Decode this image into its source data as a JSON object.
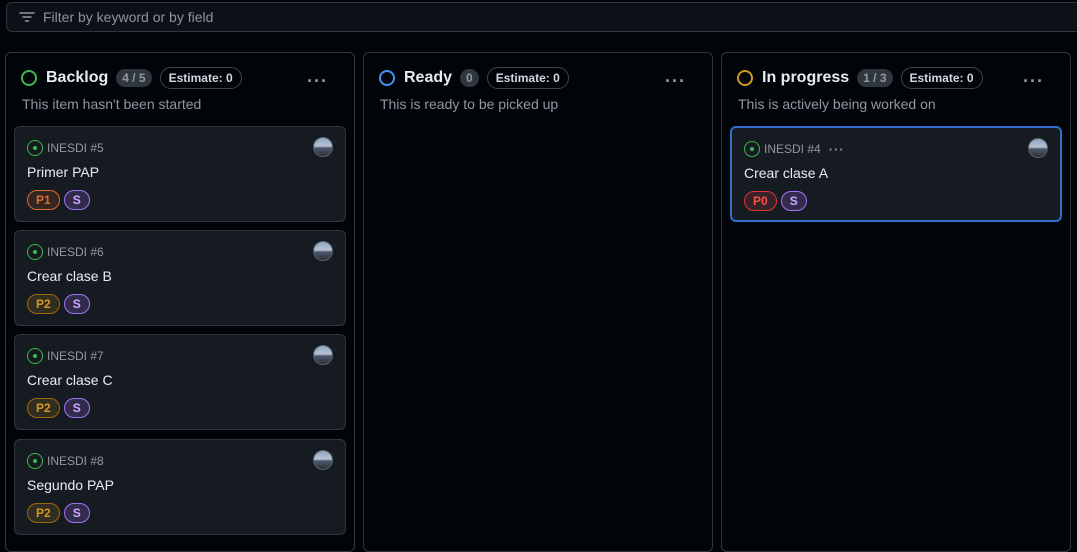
{
  "filter": {
    "placeholder": "Filter by keyword or by field"
  },
  "columns": [
    {
      "title": "Backlog",
      "count": "4 / 5",
      "estimate": "Estimate: 0",
      "description": "This item hasn't been started",
      "status_color": "#3fb950",
      "cards": [
        {
          "ref": "INESDI #5",
          "title": "Primer PAP",
          "priority": "P1",
          "size": "S"
        },
        {
          "ref": "INESDI #6",
          "title": "Crear clase B",
          "priority": "P2",
          "size": "S"
        },
        {
          "ref": "INESDI #7",
          "title": "Crear clase C",
          "priority": "P2",
          "size": "S"
        },
        {
          "ref": "INESDI #8",
          "title": "Segundo PAP",
          "priority": "P2",
          "size": "S"
        }
      ]
    },
    {
      "title": "Ready",
      "count": "0",
      "estimate": "Estimate: 0",
      "description": "This is ready to be picked up",
      "status_color": "#4493f8",
      "cards": []
    },
    {
      "title": "In progress",
      "count": "1 / 3",
      "estimate": "Estimate: 0",
      "description": "This is actively being worked on",
      "status_color": "#d29922",
      "cards": [
        {
          "ref": "INESDI #4",
          "title": "Crear clase A",
          "priority": "P0",
          "size": "S"
        }
      ]
    }
  ],
  "colors": {
    "P0": "#f85149",
    "P1": "#db6d28",
    "P2": "#d29922",
    "S": "#a371f7"
  }
}
